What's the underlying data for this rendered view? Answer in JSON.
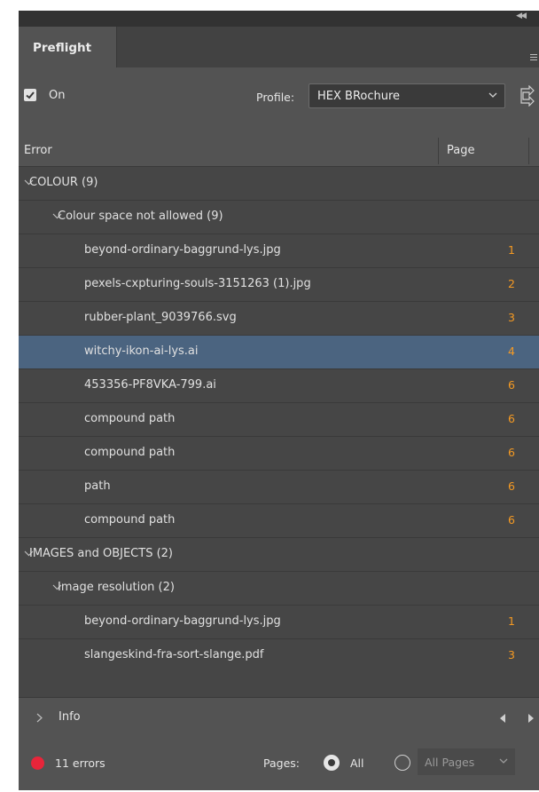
{
  "panel": {
    "tab_label": "Preflight",
    "on_label": "On",
    "on_checked": true,
    "profile_label": "Profile:",
    "profile_value": "HEX BRochure"
  },
  "table": {
    "col_error": "Error",
    "col_page": "Page",
    "rows": [
      {
        "level": 0,
        "text": "COLOUR (9)",
        "page": "",
        "expanded": true
      },
      {
        "level": 1,
        "text": "Colour space not allowed (9)",
        "page": "",
        "expanded": true
      },
      {
        "level": 2,
        "text": "beyond-ordinary-baggrund-lys.jpg",
        "page": "1"
      },
      {
        "level": 2,
        "text": "pexels-cxpturing-souls-3151263 (1).jpg",
        "page": "2"
      },
      {
        "level": 2,
        "text": "rubber-plant_9039766.svg",
        "page": "3"
      },
      {
        "level": 2,
        "text": "witchy-ikon-ai-lys.ai",
        "page": "4",
        "selected": true
      },
      {
        "level": 2,
        "text": "453356-PF8VKA-799.ai",
        "page": "6"
      },
      {
        "level": 2,
        "text": "compound path",
        "page": "6"
      },
      {
        "level": 2,
        "text": "compound path",
        "page": "6"
      },
      {
        "level": 2,
        "text": "path",
        "page": "6"
      },
      {
        "level": 2,
        "text": "compound path",
        "page": "6"
      },
      {
        "level": 0,
        "text": "IMAGES and OBJECTS (2)",
        "page": "",
        "expanded": true
      },
      {
        "level": 1,
        "text": "Image resolution (2)",
        "page": "",
        "expanded": true
      },
      {
        "level": 2,
        "text": "beyond-ordinary-baggrund-lys.jpg",
        "page": "1"
      },
      {
        "level": 2,
        "text": "slangeskind-fra-sort-slange.pdf",
        "page": "3"
      }
    ]
  },
  "info": {
    "label": "Info"
  },
  "status": {
    "errors_text": "11 errors",
    "status_color": "#e8253a",
    "pages_label": "Pages:",
    "all_label": "All",
    "all_selected": true,
    "range_placeholder": "All Pages"
  },
  "colors": {
    "panel_bg": "#535353",
    "list_bg": "#464646",
    "selected_row": "#4b6480",
    "page_number": "#f59a23"
  }
}
